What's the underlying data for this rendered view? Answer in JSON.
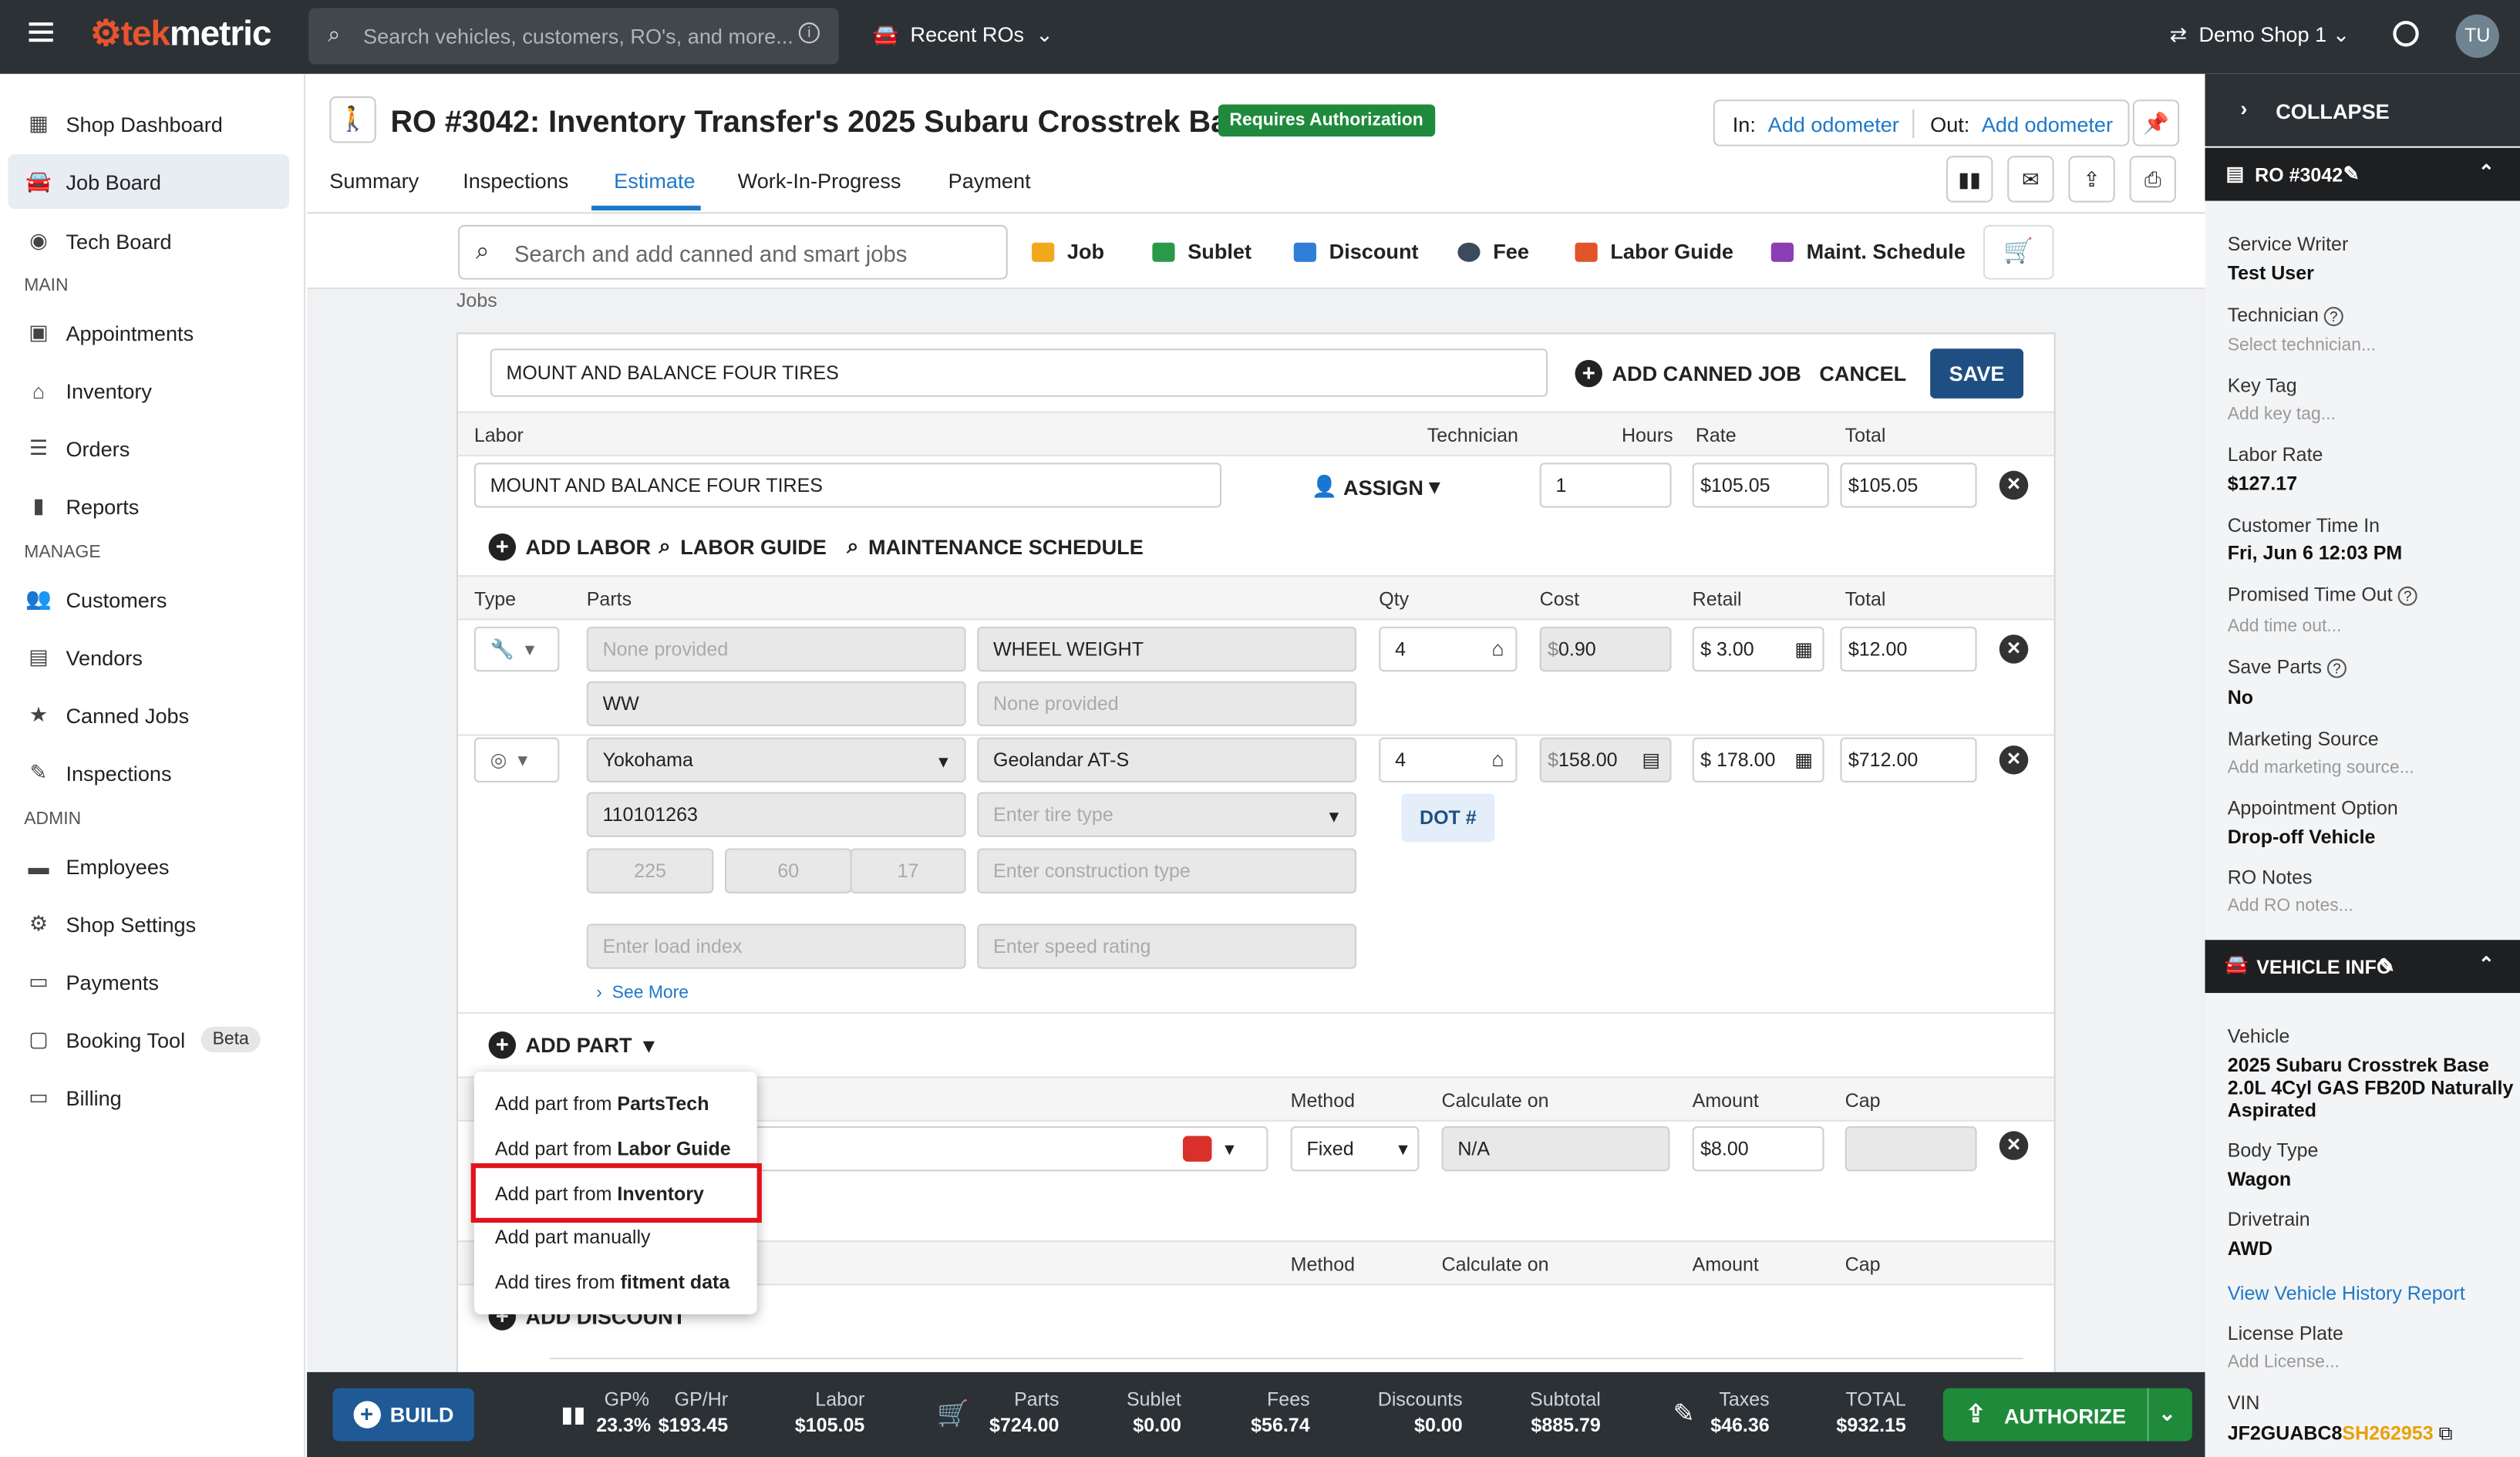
{
  "app": {
    "brand_prefix": "tek",
    "brand_suffix": "metric"
  },
  "topbar": {
    "search_placeholder": "Search vehicles, customers, RO's, and more...",
    "recent": "Recent ROs",
    "shop": "Demo Shop 1",
    "avatar": "TU"
  },
  "sidebar": {
    "items": [
      {
        "label": "Shop Dashboard",
        "icon": "dashboard-icon"
      },
      {
        "label": "Job Board",
        "icon": "car-icon"
      },
      {
        "label": "Tech Board",
        "icon": "speedometer-icon"
      }
    ],
    "main_section": "MAIN",
    "main_items": [
      {
        "label": "Appointments",
        "icon": "calendar-icon"
      },
      {
        "label": "Inventory",
        "icon": "warehouse-icon"
      },
      {
        "label": "Orders",
        "icon": "list-icon"
      },
      {
        "label": "Reports",
        "icon": "bar-chart-icon"
      }
    ],
    "manage_section": "MANAGE",
    "manage_items": [
      {
        "label": "Customers",
        "icon": "people-icon"
      },
      {
        "label": "Vendors",
        "icon": "store-icon"
      },
      {
        "label": "Canned Jobs",
        "icon": "star-icon"
      },
      {
        "label": "Inspections",
        "icon": "clipboard-icon"
      }
    ],
    "admin_section": "ADMIN",
    "admin_items": [
      {
        "label": "Employees",
        "icon": "briefcase-icon"
      },
      {
        "label": "Shop Settings",
        "icon": "gear-icon"
      },
      {
        "label": "Payments",
        "icon": "money-icon"
      },
      {
        "label": "Booking Tool",
        "icon": "booking-icon",
        "badge": "Beta"
      },
      {
        "label": "Billing",
        "icon": "card-icon"
      }
    ]
  },
  "header": {
    "title": "RO #3042: Inventory Transfer's 2025 Subaru Crosstrek Base",
    "status": "Requires Authorization",
    "in_label": "In:",
    "in_link": "Add odometer",
    "out_label": "Out:",
    "out_link": "Add odometer",
    "tabs": [
      "Summary",
      "Inspections",
      "Estimate",
      "Work-In-Progress",
      "Payment"
    ]
  },
  "toolbar": {
    "search_placeholder": "Search and add canned and smart jobs",
    "job": "Job",
    "sublet": "Sublet",
    "discount": "Discount",
    "fee": "Fee",
    "labor_guide": "Labor Guide",
    "maint": "Maint. Schedule"
  },
  "jobs_label": "Jobs",
  "job": {
    "name": "MOUNT AND BALANCE FOUR TIRES",
    "add_canned": "ADD CANNED JOB",
    "cancel": "CANCEL",
    "save": "SAVE",
    "labor_headers": {
      "labor": "Labor",
      "tech": "Technician",
      "hours": "Hours",
      "rate": "Rate",
      "total": "Total"
    },
    "labor": {
      "desc": "MOUNT AND BALANCE FOUR TIRES",
      "assign": "ASSIGN",
      "hours": "1",
      "rate": "105.05",
      "total": "105.05"
    },
    "labor_buttons": {
      "add_labor": "ADD LABOR",
      "labor_guide": "LABOR GUIDE",
      "maint": "MAINTENANCE SCHEDULE"
    },
    "parts_headers": {
      "type": "Type",
      "parts": "Parts",
      "qty": "Qty",
      "cost": "Cost",
      "retail": "Retail",
      "total": "Total"
    },
    "part1": {
      "brand_ph": "None provided",
      "name": "WHEEL WEIGHT",
      "qty": "4",
      "cost": "0.90",
      "retail": "3.00",
      "total": "12.00",
      "number": "WW",
      "desc_ph": "None provided"
    },
    "part2": {
      "brand": "Yokohama",
      "name": "Geolandar AT-S",
      "qty": "4",
      "cost": "158.00",
      "retail": "178.00",
      "total": "712.00",
      "number": "110101263",
      "tire_type_ph": "Enter tire type",
      "dot": "DOT #",
      "w": "225",
      "ar": "60",
      "rim": "17",
      "constr_ph": "Enter construction type",
      "load_ph": "Enter load index",
      "speed_ph": "Enter speed rating",
      "see_more": "See More"
    },
    "add_part": "ADD PART",
    "fee_headers": {
      "method": "Method",
      "calc": "Calculate on",
      "amount": "Amount",
      "cap": "Cap"
    },
    "fee": {
      "method": "Fixed",
      "calc": "N/A",
      "amount": "8.00"
    },
    "add_discount": "ADD DISCOUNT"
  },
  "menu": [
    {
      "pre": "Add part from ",
      "bold": "PartsTech"
    },
    {
      "pre": "Add part from ",
      "bold": "Labor Guide"
    },
    {
      "pre": "Add part from ",
      "bold": "Inventory"
    },
    {
      "pre": "Add part manually",
      "bold": ""
    },
    {
      "pre": "Add tires from ",
      "bold": "fitment data"
    }
  ],
  "footer": {
    "build": "BUILD",
    "gp_t": "GP%",
    "gp_v": "23.3%",
    "gphr_t": "GP/Hr",
    "gphr_v": "$193.45",
    "labor_t": "Labor",
    "labor_v": "$105.05",
    "parts_t": "Parts",
    "parts_v": "$724.00",
    "sublet_t": "Sublet",
    "sublet_v": "$0.00",
    "fees_t": "Fees",
    "fees_v": "$56.74",
    "disc_t": "Discounts",
    "disc_v": "$0.00",
    "sub_t": "Subtotal",
    "sub_v": "$885.79",
    "tax_t": "Taxes",
    "tax_v": "$46.36",
    "total_t": "TOTAL",
    "total_v": "$932.15",
    "authorize": "AUTHORIZE"
  },
  "right": {
    "collapse": "COLLAPSE",
    "ro_head": "RO #3042",
    "service_writer_l": "Service Writer",
    "service_writer_v": "Test User",
    "technician_l": "Technician",
    "technician_h": "Select technician...",
    "keytag_l": "Key Tag",
    "keytag_h": "Add key tag...",
    "laborrate_l": "Labor Rate",
    "laborrate_v": "$127.17",
    "custin_l": "Customer Time In",
    "custin_v": "Fri, Jun 6 12:03 PM",
    "promised_l": "Promised Time Out",
    "promised_h": "Add time out...",
    "saveparts_l": "Save Parts",
    "saveparts_v": "No",
    "marketing_l": "Marketing Source",
    "marketing_h": "Add marketing source...",
    "appt_l": "Appointment Option",
    "appt_v": "Drop-off Vehicle",
    "notes_l": "RO Notes",
    "notes_h": "Add RO notes...",
    "vehicle_head": "VEHICLE INFO",
    "vehicle_l": "Vehicle",
    "vehicle_v1": "2025 Subaru Crosstrek Base",
    "vehicle_v2": "2.0L 4Cyl GAS FB20D Naturally",
    "vehicle_v3": "Aspirated",
    "body_l": "Body Type",
    "body_v": "Wagon",
    "drive_l": "Drivetrain",
    "drive_v": "AWD",
    "history": "View Vehicle History Report",
    "plate_l": "License Plate",
    "plate_h": "Add License...",
    "vin_l": "VIN",
    "vin_a": "JF2GUABC8",
    "vin_b": "SH262953"
  }
}
